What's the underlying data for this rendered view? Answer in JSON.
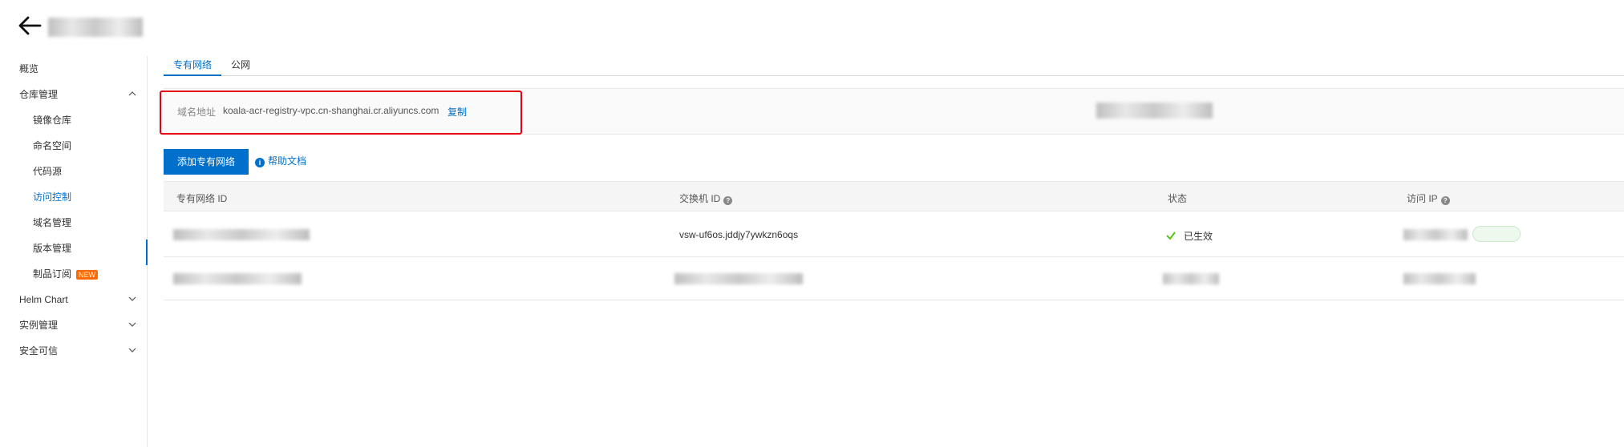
{
  "header": {
    "back_icon": "arrow-left-icon"
  },
  "sidebar": {
    "items": [
      {
        "label": "概览"
      },
      {
        "label": "仓库管理"
      },
      {
        "label": "镜像仓库"
      },
      {
        "label": "命名空间"
      },
      {
        "label": "代码源"
      },
      {
        "label": "访问控制"
      },
      {
        "label": "域名管理"
      },
      {
        "label": "版本管理"
      },
      {
        "label": "制品订阅",
        "badge": "NEW"
      },
      {
        "label": "Helm Chart"
      },
      {
        "label": "实例管理"
      },
      {
        "label": "安全可信"
      }
    ]
  },
  "tabs": [
    {
      "label": "专有网络"
    },
    {
      "label": "公网"
    }
  ],
  "domain": {
    "label": "域名地址",
    "value": "koala-acr-registry-vpc.cn-shanghai.cr.aliyuncs.com",
    "copy_label": "复制"
  },
  "actions": {
    "add_label": "添加专有网络",
    "help_label": "帮助文档"
  },
  "table": {
    "headers": [
      "专有网络 ID",
      "交换机 ID",
      "状态",
      "访问 IP"
    ],
    "rows": [
      {
        "vswitch_id": "vsw-uf6os.jddjy7ywkzn6oqs",
        "status": "已生效"
      }
    ]
  },
  "colors": {
    "accent": "#0070cc",
    "highlight": "#e60012",
    "badge": "#ff6a00",
    "success": "#52c41a"
  }
}
